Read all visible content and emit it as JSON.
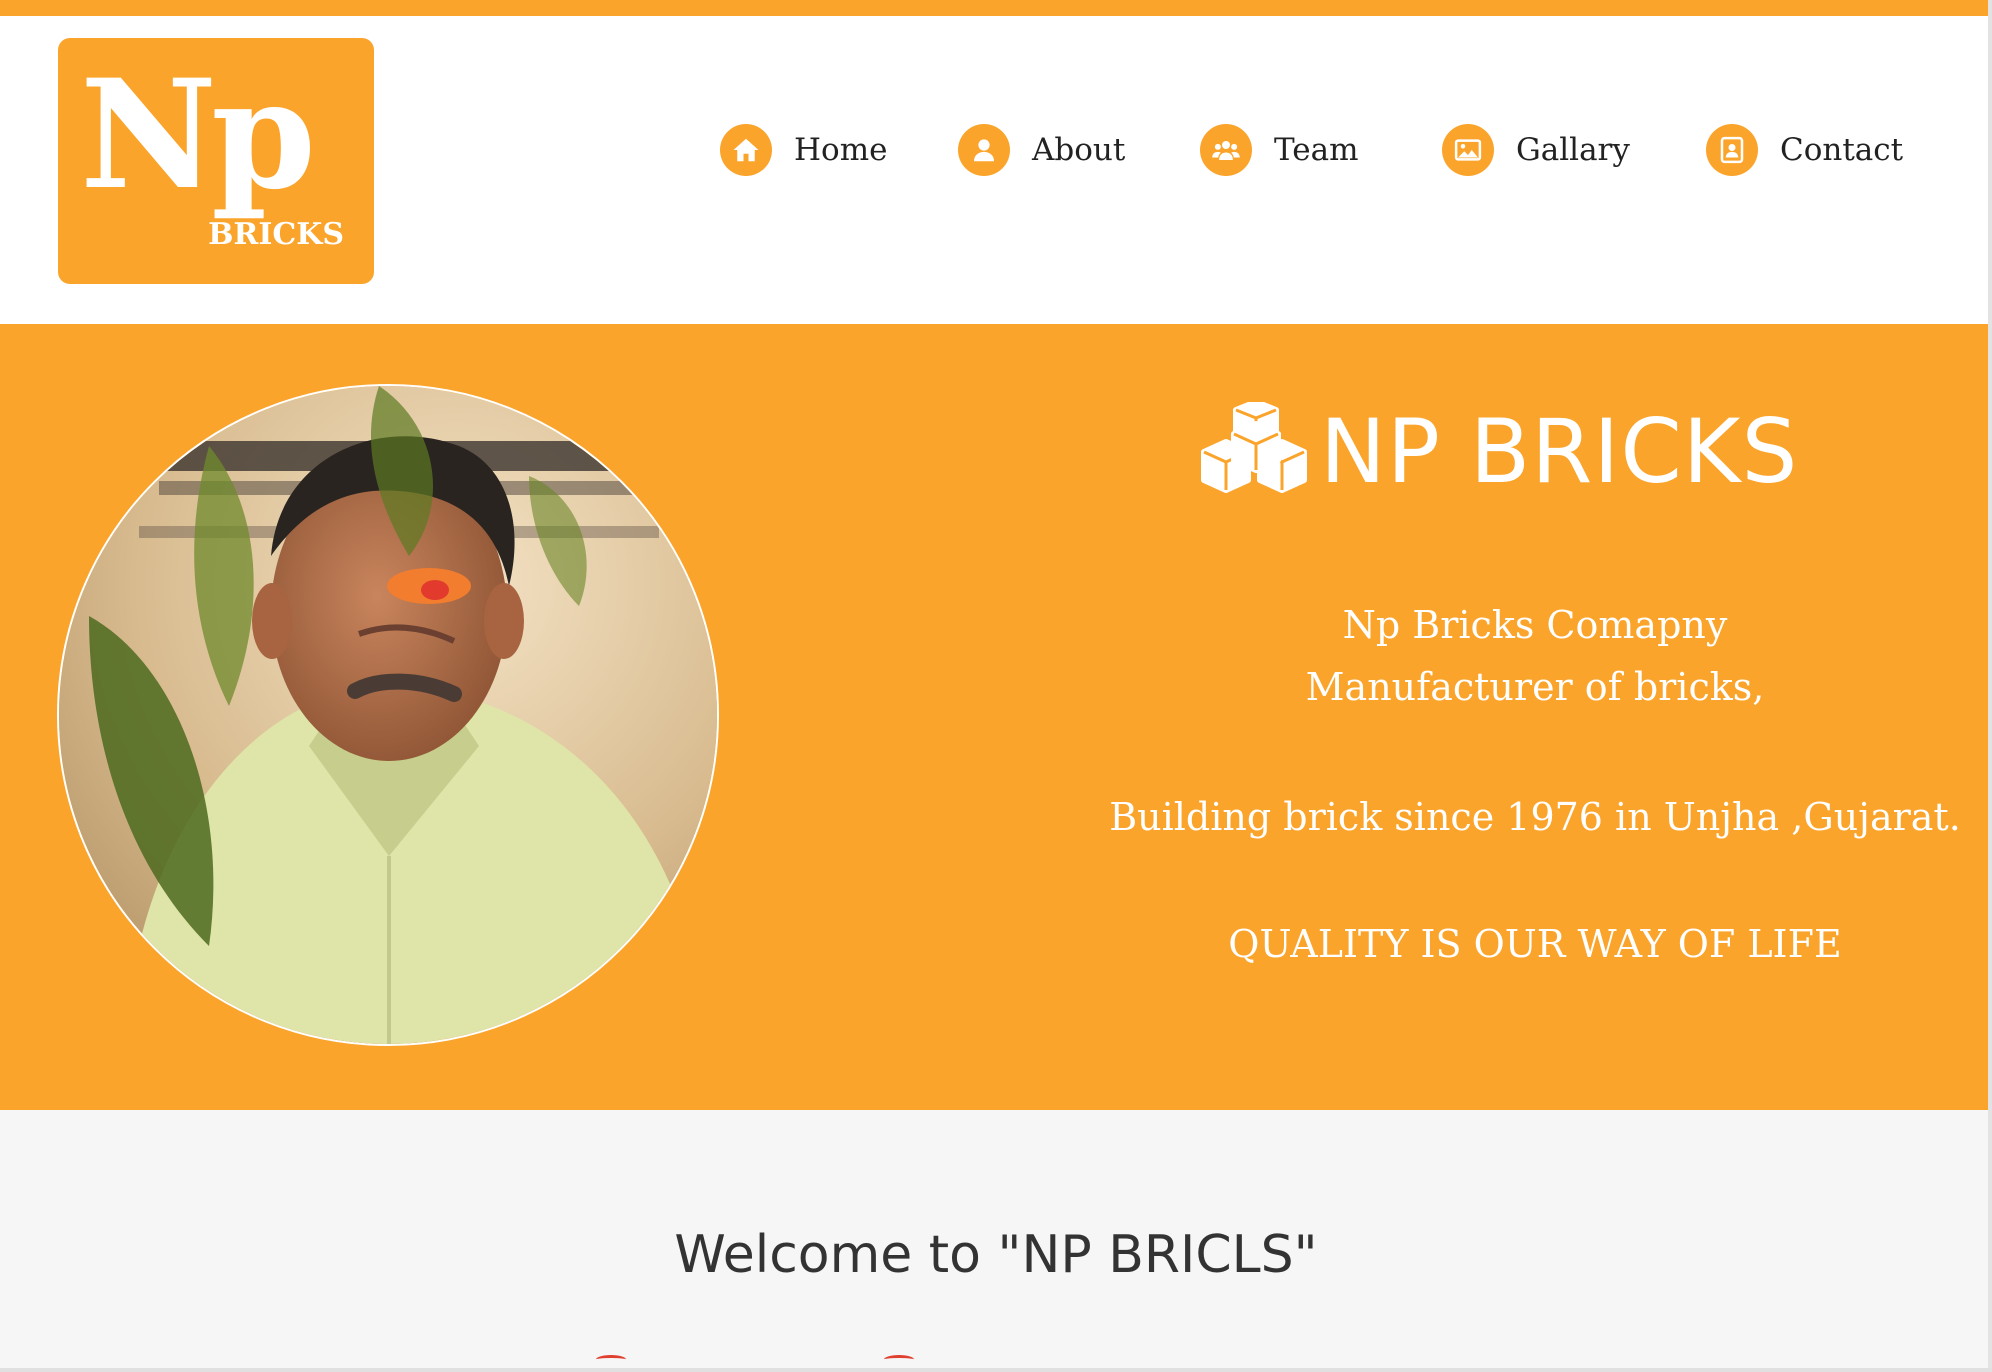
{
  "colors": {
    "accent": "#FBA42B",
    "nav_text": "#222222",
    "hero_text": "#FFFFFF",
    "welcome_bg": "#F6F6F6",
    "welcome_text": "#333333"
  },
  "logo": {
    "main": "Np",
    "sub": "BRICKS"
  },
  "nav": {
    "items": [
      {
        "label": "Home",
        "icon": "home-icon"
      },
      {
        "label": "About",
        "icon": "user-icon"
      },
      {
        "label": "Team",
        "icon": "team-icon"
      },
      {
        "label": "Gallary",
        "icon": "image-icon"
      },
      {
        "label": "Contact",
        "icon": "contact-card-icon"
      }
    ]
  },
  "hero": {
    "title": "NP BRICKS",
    "title_icon": "cubes-icon",
    "line1": "Np Bricks Comapny",
    "line2": "Manufacturer of  bricks,",
    "line3": "Building brick since 1976 in Unjha ,Gujarat.",
    "tagline": "QUALITY IS OUR WAY OF LIFE",
    "portrait": "portrait-photo"
  },
  "welcome": {
    "title": "Welcome to \"NP BRICLS\""
  }
}
